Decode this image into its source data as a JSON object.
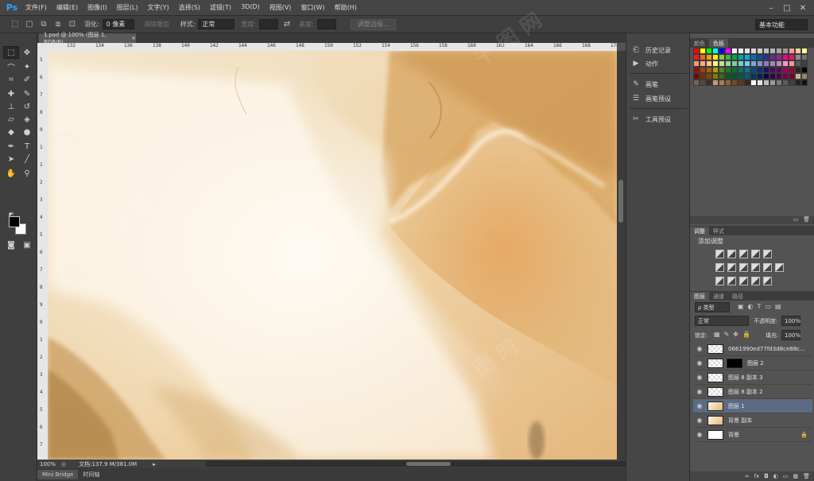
{
  "app": {
    "logo": "Ps"
  },
  "menu": [
    "文件(F)",
    "编辑(E)",
    "图像(I)",
    "图层(L)",
    "文字(Y)",
    "选择(S)",
    "滤镜(T)",
    "3D(D)",
    "视图(V)",
    "窗口(W)",
    "帮助(H)"
  ],
  "window_controls": [
    "–",
    "□",
    "✕"
  ],
  "options": {
    "feather_label": "羽化:",
    "feather_value": "0 像素",
    "antialias_label": "消除锯齿",
    "style_label": "样式:",
    "style_value": "正常",
    "width_label": "宽度:",
    "height_label": "高度:",
    "refine_button": "调整边缘...",
    "workspace": "基本功能"
  },
  "document": {
    "tab_title": "1.psd @ 100% (图层 1, RGB/8)",
    "tab_close": "×"
  },
  "ruler": {
    "h_ticks": [
      "132",
      "134",
      "136",
      "138",
      "140",
      "142",
      "144",
      "146",
      "148",
      "150",
      "152",
      "154",
      "156",
      "158",
      "160",
      "162",
      "164",
      "166",
      "168",
      "170"
    ],
    "v_ticks": [
      "5",
      "6",
      "7",
      "8",
      "9",
      "1",
      "1",
      "2",
      "3",
      "4",
      "5",
      "6",
      "7",
      "8",
      "9",
      "0",
      "1",
      "2",
      "3",
      "4",
      "5",
      "6",
      "7"
    ]
  },
  "status": {
    "zoom": "100%",
    "doc_info": "文档:137.9 M/381.0M",
    "arrow": "▸"
  },
  "bottom_tabs": [
    "Mini Bridge",
    "时间轴"
  ],
  "dock_mid": {
    "items": [
      {
        "icon": "history-icon",
        "glyph": "⎗",
        "label": "历史记录"
      },
      {
        "icon": "actions-icon",
        "glyph": "▶",
        "label": "动作"
      },
      {
        "icon": "brush-icon",
        "glyph": "✎",
        "label": "画笔"
      },
      {
        "icon": "brush-presets-icon",
        "glyph": "☰",
        "label": "画笔预设"
      },
      {
        "icon": "tool-presets-icon",
        "glyph": "✂",
        "label": "工具预设"
      }
    ]
  },
  "swatches_panel": {
    "tabs": [
      "颜色",
      "色板"
    ],
    "colors": [
      "#ff0000",
      "#ffff00",
      "#00ff00",
      "#00ffff",
      "#0000ff",
      "#ff00ff",
      "#ffffff",
      "#f2f2f2",
      "#e6e6e6",
      "#d9d9d9",
      "#cccccc",
      "#bfbfbf",
      "#b3b3b3",
      "#a6a6a6",
      "#999999",
      "#ff9999",
      "#ffcc99",
      "#ffff99",
      "#ed1c24",
      "#f26522",
      "#f7941d",
      "#fff200",
      "#8dc63f",
      "#39b54a",
      "#00a651",
      "#00a99d",
      "#00aeef",
      "#0072bc",
      "#0054a6",
      "#2e3192",
      "#662d91",
      "#92278f",
      "#ec008c",
      "#ed145b",
      "#8c8c8c",
      "#737373",
      "#f69679",
      "#f9ad81",
      "#fdc68a",
      "#fff79a",
      "#c4df9b",
      "#a3d39c",
      "#82ca9d",
      "#7accc8",
      "#6dcff6",
      "#7da7d9",
      "#8393ca",
      "#8781bd",
      "#a186be",
      "#bd8cbf",
      "#f49ac1",
      "#f5989d",
      "#595959",
      "#404040",
      "#9e0b0f",
      "#a0410d",
      "#a36209",
      "#aba000",
      "#598527",
      "#1a7b30",
      "#007236",
      "#00746b",
      "#0076a3",
      "#004a80",
      "#003471",
      "#1b1464",
      "#440e62",
      "#630460",
      "#9e005d",
      "#9e0039",
      "#262626",
      "#000000",
      "#790000",
      "#7b2e00",
      "#7d4900",
      "#827b00",
      "#406618",
      "#005e20",
      "#005826",
      "#005952",
      "#005b7f",
      "#003663",
      "#002157",
      "#0d004c",
      "#32004b",
      "#4b0049",
      "#7b0046",
      "#7a0026",
      "#c7b299",
      "#998675",
      "#736357",
      "#534741",
      "#37302a",
      "#c69c6d",
      "#a67c52",
      "#8c6239",
      "#754c24",
      "#603913",
      "#3c2415",
      "#ffffff",
      "#e6e6e6",
      "#bdbdbd",
      "#9a9a9a",
      "#7a7a7a",
      "#5c5c5c",
      "#3f3f3f",
      "#222222",
      "#111111"
    ]
  },
  "adjustments_panel": {
    "tabs": [
      "调整",
      "样式"
    ],
    "title": "添加调整"
  },
  "layers_panel": {
    "tabs": [
      "图层",
      "通道",
      "路径"
    ],
    "filter": "ρ 类型",
    "blend_mode": "正常",
    "opacity_label": "不透明度:",
    "opacity_value": "100%",
    "lock_label": "锁定:",
    "fill_label": "填充:",
    "fill_value": "100%",
    "layers": [
      {
        "name": "0661990ed77fd3d8ce88c...",
        "selected": false,
        "thumb": "checker",
        "mask": false,
        "lock": ""
      },
      {
        "name": "图层 2",
        "selected": false,
        "thumb": "checker",
        "mask": true,
        "lock": ""
      },
      {
        "name": "图层 8 副本 3",
        "selected": false,
        "thumb": "checker",
        "mask": false,
        "lock": ""
      },
      {
        "name": "图层 8 副本 2",
        "selected": false,
        "thumb": "checker",
        "mask": false,
        "lock": ""
      },
      {
        "name": "图层 1",
        "selected": true,
        "thumb": "marble",
        "mask": false,
        "lock": ""
      },
      {
        "name": "背景 副本",
        "selected": false,
        "thumb": "marble",
        "mask": false,
        "lock": ""
      },
      {
        "name": "背景",
        "selected": false,
        "thumb": "white",
        "mask": false,
        "lock": "🔒"
      }
    ],
    "footer_icons": [
      "∞",
      "fx",
      "◘",
      "◐",
      "▭",
      "▦",
      "🗑"
    ]
  }
}
